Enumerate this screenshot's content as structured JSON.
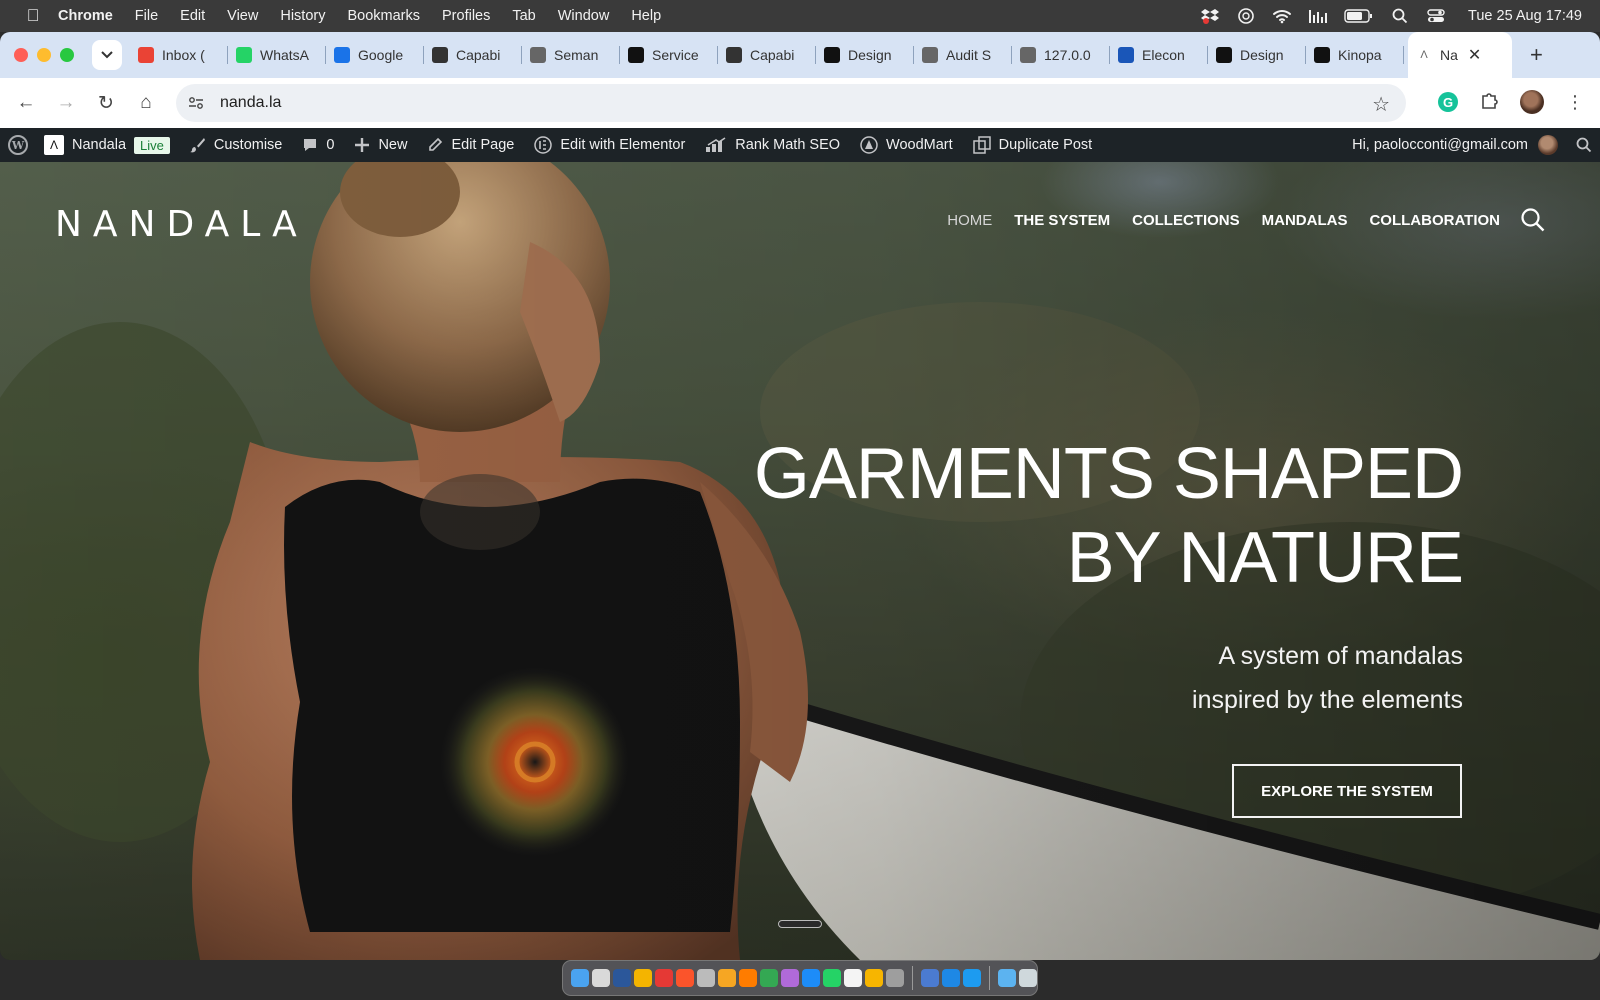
{
  "menubar": {
    "app": "Chrome",
    "items": [
      "File",
      "Edit",
      "View",
      "History",
      "Bookmarks",
      "Profiles",
      "Tab",
      "Window",
      "Help"
    ],
    "clock": "Tue 25 Aug  17:49"
  },
  "tabs": [
    {
      "label": "Inbox (",
      "icon": "gmail-icon",
      "color": "#ea4335"
    },
    {
      "label": "WhatsA",
      "icon": "whatsapp-icon",
      "color": "#25d366"
    },
    {
      "label": "Google",
      "icon": "google-calendar-icon",
      "color": "#1a73e8"
    },
    {
      "label": "Capabi",
      "icon": "capabilities-icon",
      "color": "#333333"
    },
    {
      "label": "Seman",
      "icon": "globe-icon",
      "color": "#666666"
    },
    {
      "label": "Service",
      "icon": "service-icon",
      "color": "#111111"
    },
    {
      "label": "Capabi",
      "icon": "capabilities-icon",
      "color": "#333333"
    },
    {
      "label": "Design",
      "icon": "design-icon",
      "color": "#111111"
    },
    {
      "label": "Audit S",
      "icon": "globe-icon",
      "color": "#666666"
    },
    {
      "label": "127.0.0",
      "icon": "globe-icon",
      "color": "#666666"
    },
    {
      "label": "Elecon",
      "icon": "elementor-icon",
      "color": "#1a56b8"
    },
    {
      "label": "Design",
      "icon": "design-icon",
      "color": "#111111"
    },
    {
      "label": "Kinopa",
      "icon": "kinopanorama-icon",
      "color": "#111111"
    }
  ],
  "active_tab": {
    "label": "Na",
    "icon": "nandala-icon"
  },
  "toolbar": {
    "url": "nanda.la"
  },
  "wpbar": {
    "site": "Nandala",
    "live": "Live",
    "customise": "Customise",
    "comments": "0",
    "new": "New",
    "edit_page": "Edit Page",
    "elementor": "Edit with Elementor",
    "rankmath": "Rank Math SEO",
    "woodmart": "WoodMart",
    "duplicate": "Duplicate Post",
    "greeting": "Hi, paolocconti@gmail.com"
  },
  "site": {
    "logo": "NANDALA",
    "nav": [
      {
        "label": "HOME",
        "active": true
      },
      {
        "label": "THE SYSTEM"
      },
      {
        "label": "COLLECTIONS"
      },
      {
        "label": "MANDALAS"
      },
      {
        "label": "COLLABORATION"
      }
    ],
    "hero_title_line1": "GARMENTS SHAPED",
    "hero_title_line2": "BY NATURE",
    "hero_sub_line1": "A system of mandalas",
    "hero_sub_line2": "inspired by the elements",
    "cta": "EXPLORE THE SYSTEM"
  },
  "dock": {
    "icons": [
      "finder-icon",
      "launchpad-icon",
      "word-icon",
      "chrome-icon",
      "opera-icon",
      "brave-icon",
      "chatgpt-icon",
      "app-icon",
      "illustrator-icon",
      "numbers-icon",
      "affinity-icon",
      "app-store-icon",
      "whatsapp-icon",
      "notes-icon",
      "sketch-icon",
      "settings-icon",
      "preview-icon",
      "downloads-icon",
      "safari-icon",
      "folder-icon",
      "trash-icon"
    ],
    "colors": [
      "#4aa3f0",
      "#d9d9d9",
      "#2b579a",
      "#f4b400",
      "#e53935",
      "#fb542b",
      "#bbbbbb",
      "#f6a623",
      "#ff7c00",
      "#34a853",
      "#b06ad9",
      "#1d8cf8",
      "#25d366",
      "#f4f4f4",
      "#f7b500",
      "#9e9e9e",
      "#4b7bd1",
      "#1e88e5",
      "#1d9bf0",
      "#5cb3f0",
      "#cfd8dc"
    ]
  }
}
